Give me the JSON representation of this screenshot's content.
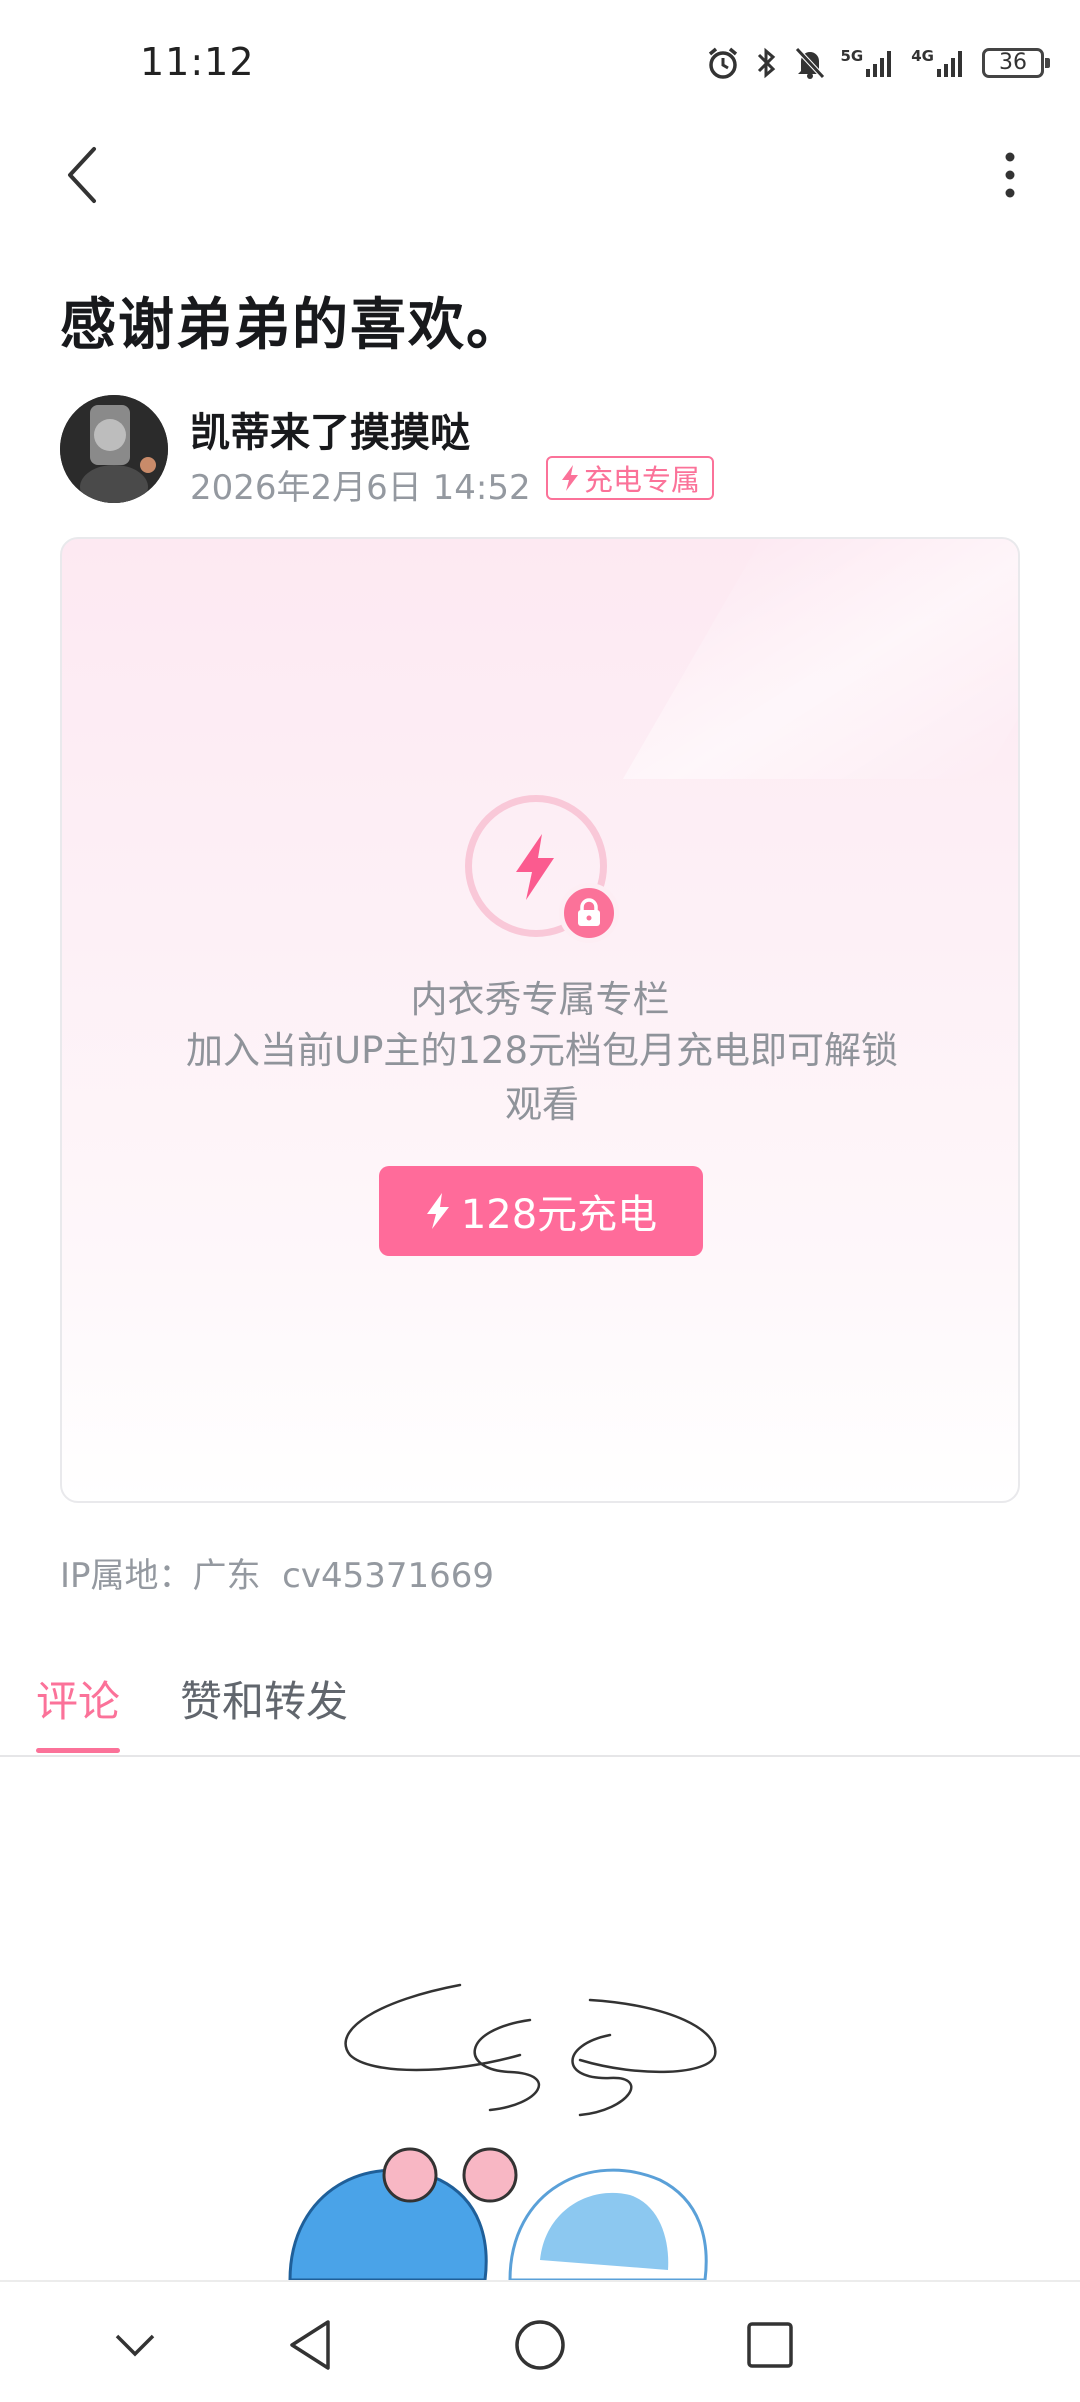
{
  "status_bar": {
    "time": "11:12",
    "network_1": "5G",
    "network_2": "4G",
    "battery": "36"
  },
  "header": {
    "back_icon": "chevron-left-icon",
    "more_icon": "more-vertical-icon"
  },
  "article": {
    "title": "感谢弟弟的喜欢。",
    "author": "凯蒂来了摸摸哒",
    "date": "2026年2月6日 14:52",
    "badge": "充电专属"
  },
  "locked_card": {
    "heading": "内衣秀专属专栏",
    "description": "加入当前UP主的128元档包月充电即可解锁观看",
    "button_label": "128元充电",
    "accent": "#fb7299"
  },
  "meta": {
    "ip_text": "IP属地：广东",
    "cv_id": "cv45371669"
  },
  "tabs": [
    {
      "label": "评论",
      "active": true
    },
    {
      "label": "赞和转发",
      "active": false
    }
  ],
  "navbar": {
    "icons": [
      "chevron-down-icon",
      "back-triangle-icon",
      "home-circle-icon",
      "recents-square-icon"
    ]
  }
}
